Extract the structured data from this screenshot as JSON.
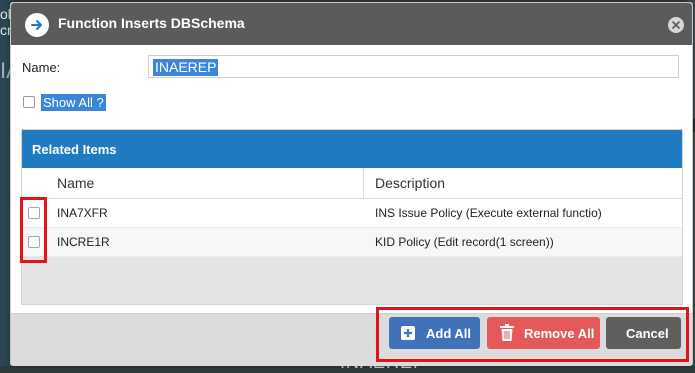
{
  "background": {
    "left_text_1": "ol",
    "left_text_2": "cr",
    "left_big": "IA",
    "bottom_text": "INAEREP"
  },
  "dialog": {
    "title": "Function Inserts DBSchema",
    "title_icon": "arrow-right-icon",
    "close_icon": "close-icon"
  },
  "form": {
    "name_label": "Name:",
    "name_value": "INAEREP",
    "show_all_label": "Show All ?",
    "show_all_checked": false
  },
  "related": {
    "header": "Related Items",
    "columns": {
      "name": "Name",
      "description": "Description"
    },
    "rows": [
      {
        "name": "INA7XFR",
        "description": "INS Issue Policy (Execute external functio)",
        "checked": false
      },
      {
        "name": "INCRE1R",
        "description": "KID Policy (Edit record(1 screen))",
        "checked": false
      }
    ]
  },
  "buttons": {
    "add_all": "Add All",
    "remove_all": "Remove All",
    "cancel": "Cancel"
  },
  "colors": {
    "title_bar": "#5b5b5b",
    "panel_header": "#1f7bc0",
    "add_button": "#3f72b8",
    "remove_button": "#e45a5a",
    "cancel_button": "#5f5f5f",
    "highlight": "#e0141b",
    "selection": "#3b86d9"
  }
}
